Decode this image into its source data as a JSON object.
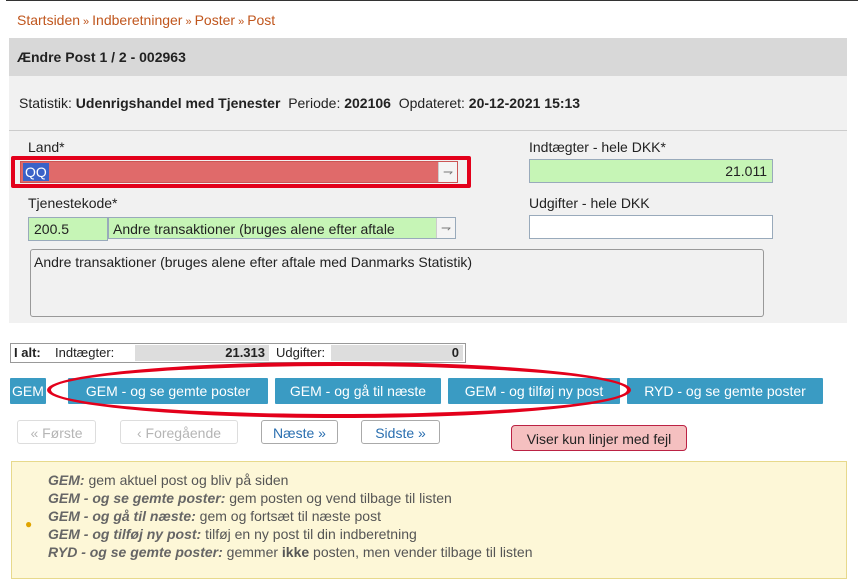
{
  "breadcrumb": [
    "Startsiden",
    "Indberetninger",
    "Poster",
    "Post"
  ],
  "breadcrumb_separator": "»",
  "page_title": "Ændre Post 1 / 2 - 002963",
  "meta": {
    "statistik_label": "Statistik:",
    "statistik_value": "Udenrigshandel med Tjenester",
    "periode_label": "Periode:",
    "periode_value": "202106",
    "opdateret_label": "Opdateret:",
    "opdateret_value": "20-12-2021 15:13"
  },
  "form": {
    "land_label": "Land*",
    "land_value": "QQ",
    "indtaegter_label": "Indtægter - hele DKK*",
    "indtaegter_value": "21.011",
    "tjenestekode_label": "Tjenestekode*",
    "tjenestekode_code": "200.5",
    "tjenestekode_desc": "Andre transaktioner (bruges alene efter aftale",
    "udgifter_label": "Udgifter - hele DKK",
    "udgifter_value": "",
    "description": "Andre transaktioner (bruges alene efter aftale med Danmarks Statistik)"
  },
  "totals": {
    "i_alt": "I alt:",
    "indtaegter_label": "Indtægter:",
    "indtaegter_value": "21.313",
    "udgifter_label": "Udgifter:",
    "udgifter_value": "0"
  },
  "actions": {
    "gem": "GEM",
    "gem_se": "GEM - og se gemte poster",
    "gem_naeste": "GEM - og gå til næste",
    "gem_tilfoej": "GEM - og tilføj ny post",
    "ryd": "RYD - og se gemte poster"
  },
  "nav": {
    "foerste": "« Første",
    "foregaaende": "‹ Foregående",
    "naeste": "Næste »",
    "sidste": "Sidste »",
    "filter": "Viser kun linjer med fejl"
  },
  "help": [
    {
      "key": "GEM:",
      "text": " gem aktuel post og bliv på siden"
    },
    {
      "key": "GEM - og se gemte poster:",
      "text": " gem posten og vend tilbage til listen"
    },
    {
      "key": "GEM - og gå til næste:",
      "text": " gem og fortsæt til næste post"
    },
    {
      "key": "GEM - og tilføj ny post:",
      "text": " tilføj en ny post til din indberetning"
    },
    {
      "key": "RYD - og se gemte poster:",
      "text": " gemmer ",
      "bold": "ikke",
      "tail": " posten, men vender tilbage til listen"
    }
  ],
  "colors": {
    "accent": "#3a9bc3",
    "breadcrumb": "#c0561d",
    "error": "#e06a6a",
    "valid": "#c6f5b6",
    "annotation": "#e3001b"
  }
}
